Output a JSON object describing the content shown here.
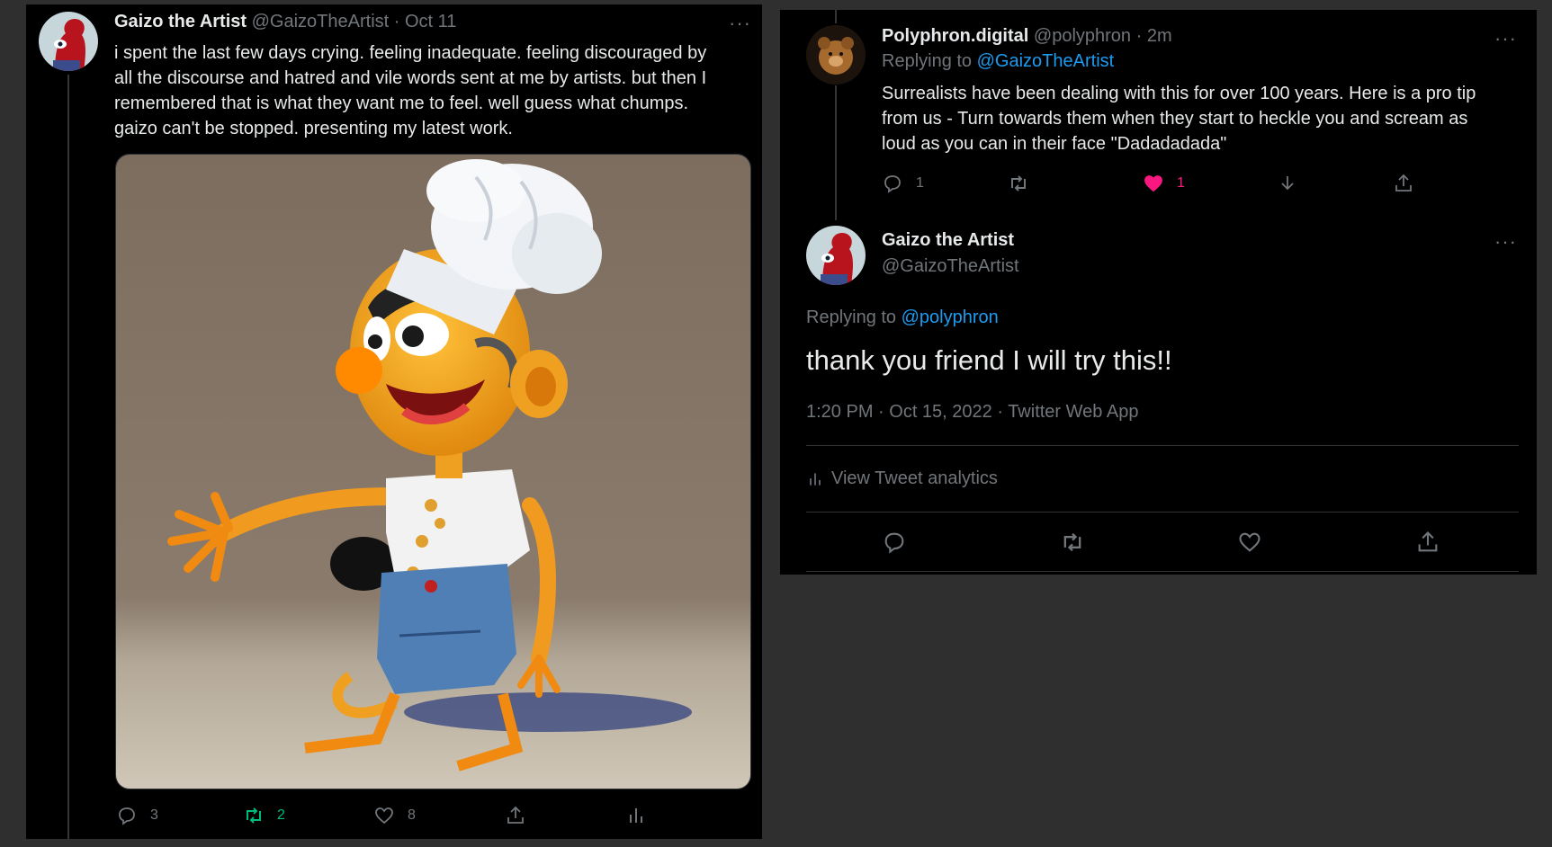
{
  "left_tweet": {
    "author_name": "Gaizo the Artist",
    "author_handle": "@GaizoTheArtist",
    "time": "· Oct 11",
    "more": "···",
    "text_lines": [
      "i spent the last few days crying. feeling inadequate. feeling discouraged by",
      "all the discourse and hatred and vile words sent at me by artists. but then I",
      "remembered that is what they want me to feel. well guess what chumps.",
      "gaizo can't be stopped. presenting my latest work."
    ],
    "actions": {
      "replies": "3",
      "retweets": "2",
      "likes": "8"
    }
  },
  "reply_tweet": {
    "author_name": "Polyphron.digital",
    "author_handle": "@polyphron",
    "time": "· 2m",
    "more": "···",
    "replying_prefix": "Replying to",
    "replying_to": "@GaizoTheArtist",
    "text_lines": [
      "Surrealists have been dealing with this for over 100 years. Here is a pro tip",
      "from us - Turn towards them when they start to heckle you and scream as",
      "loud as you can in their face \"Dadadadada\""
    ],
    "actions": {
      "replies": "1",
      "likes": "1"
    }
  },
  "focused_tweet": {
    "author_name": "Gaizo the Artist",
    "author_handle": "@GaizoTheArtist",
    "more": "···",
    "replying_prefix": "Replying to",
    "replying_to": "@polyphron",
    "text": "thank you friend I will try this!!",
    "timestamp": "1:20 PM · Oct 15, 2022 · Twitter Web App",
    "analytics_label": "View Tweet analytics"
  },
  "colors": {
    "background": "#2f2f2f",
    "panel": "#000000",
    "link": "#1d9bf0",
    "retweet_active": "#00ba7c",
    "like_active": "#f91880",
    "muted": "#71767b"
  }
}
